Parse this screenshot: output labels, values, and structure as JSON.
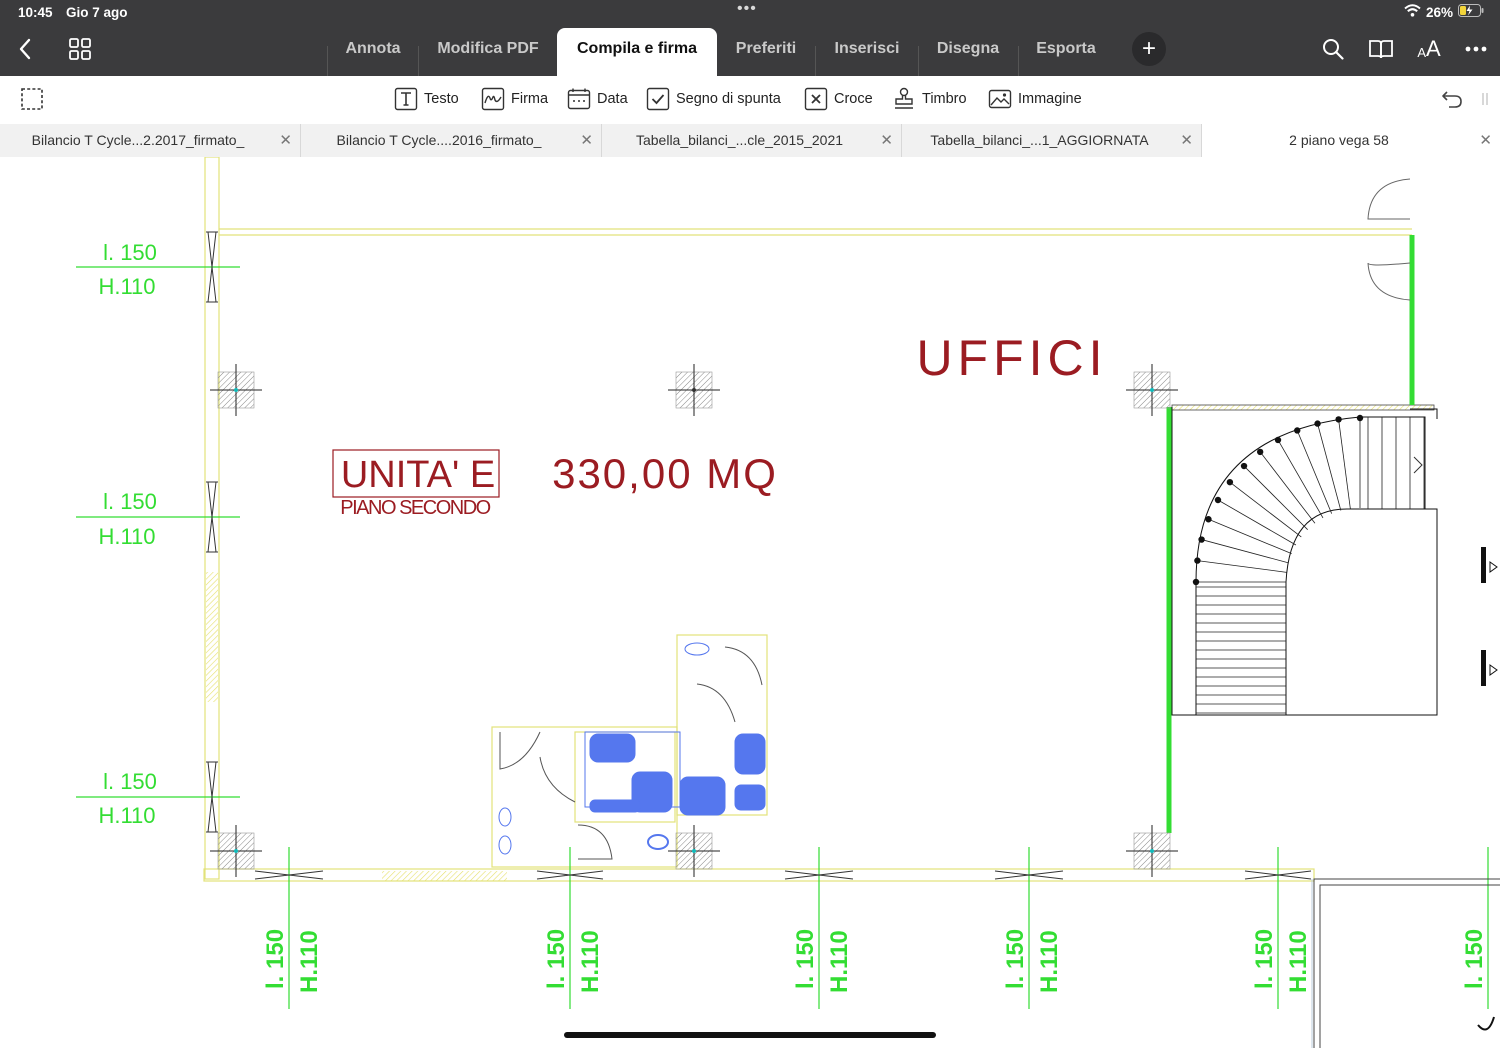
{
  "status": {
    "time": "10:45",
    "date": "Gio 7 ago",
    "battery": "26%"
  },
  "menu": {
    "tabs": [
      {
        "label": "Annota",
        "active": false
      },
      {
        "label": "Modifica PDF",
        "active": false
      },
      {
        "label": "Compila e firma",
        "active": true
      },
      {
        "label": "Preferiti",
        "active": false
      },
      {
        "label": "Inserisci",
        "active": false
      },
      {
        "label": "Disegna",
        "active": false
      },
      {
        "label": "Esporta",
        "active": false
      }
    ],
    "font_button": "AA"
  },
  "toolbar": {
    "tools": [
      {
        "label": "Testo",
        "icon": "text-box-icon"
      },
      {
        "label": "Firma",
        "icon": "signature-icon"
      },
      {
        "label": "Data",
        "icon": "calendar-icon"
      },
      {
        "label": "Segno di spunta",
        "icon": "checkmark-box-icon"
      },
      {
        "label": "Croce",
        "icon": "cross-box-icon"
      },
      {
        "label": "Timbro",
        "icon": "stamp-icon"
      },
      {
        "label": "Immagine",
        "icon": "image-icon"
      }
    ]
  },
  "document_tabs": [
    {
      "label": "Bilancio T Cycle...2.2017_firmato_",
      "active": false
    },
    {
      "label": "Bilancio T Cycle....2016_firmato_",
      "active": false
    },
    {
      "label": "Tabella_bilanci_...cle_2015_2021",
      "active": false
    },
    {
      "label": "Tabella_bilanci_...1_AGGIORNATA",
      "active": false
    },
    {
      "label": "2 piano vega 58",
      "active": true
    }
  ],
  "drawing": {
    "room_label": "UFFICI",
    "unit_label": "UNITA' E",
    "floor_label": "PIANO SECONDO",
    "area": "330,00 MQ",
    "window_width": "l. 150",
    "window_height": "H.110",
    "colors": {
      "dimension_green": "#33dd33",
      "label_red": "#9b1c22",
      "fixture_blue": "#5577ee",
      "wall_yellow": "#e2e27a"
    }
  }
}
